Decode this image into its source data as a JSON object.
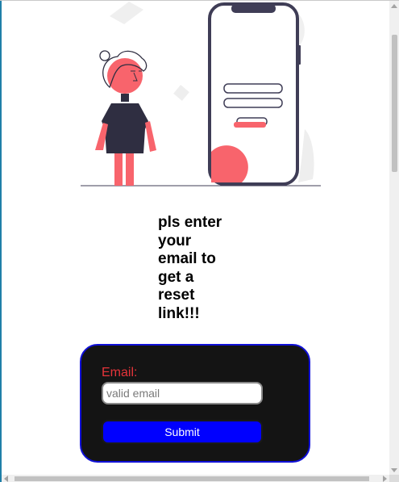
{
  "page": {
    "heading": "pls enter your email to get a reset link!!!"
  },
  "form": {
    "email_label": "Email:",
    "email_placeholder": "valid email",
    "email_value": "",
    "submit_label": "Submit"
  },
  "colors": {
    "accent_pink": "#f8646c",
    "dark_navy": "#2f2e41",
    "card_background": "#141414",
    "card_border": "#1010d8",
    "label_red": "#e5343a",
    "button_blue": "#0000ff"
  },
  "illustration": {
    "icon": "forgot-password-illustration"
  }
}
